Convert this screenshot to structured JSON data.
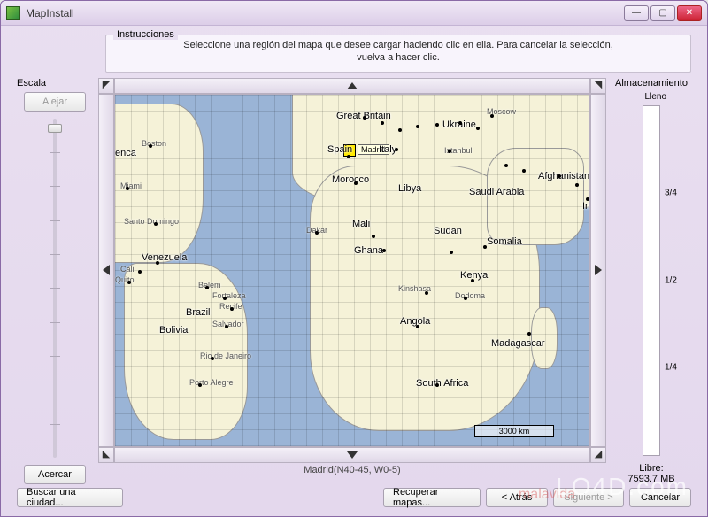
{
  "window": {
    "title": "MapInstall"
  },
  "instructions": {
    "legend": "Instrucciones",
    "body": "Seleccione una región del mapa que desee cargar haciendo clic en ella. Para cancelar la selección,\nvuelva a hacer clic."
  },
  "scale": {
    "label": "Escala",
    "zoom_out": "Alejar",
    "zoom_in": "Acercar"
  },
  "storage": {
    "label": "Almacenamiento",
    "full": "Lleno",
    "three_quarter": "3/4",
    "half": "1/2",
    "quarter": "1/4",
    "free_label": "Libre:",
    "free_value": "7593.7 MB"
  },
  "map": {
    "selected_city": "Madrid",
    "selected_coords": "Madrid(N40-45, W0-5)",
    "tooltip": "Madrid",
    "scalebar": "3000 km",
    "countries": {
      "great_britain": "Great Britain",
      "ukraine": "Ukraine",
      "spain": "Spain",
      "italy": "Italy",
      "morocco": "Morocco",
      "libya": "Libya",
      "saudi_arabia": "Saudi Arabia",
      "afghanistan": "Afghanistan",
      "india": "Ind",
      "mali": "Mali",
      "sudan": "Sudan",
      "somalia": "Somalia",
      "ghana": "Ghana",
      "kenya": "Kenya",
      "angola": "Angola",
      "madagascar": "Madagascar",
      "south_africa": "South Africa",
      "venezuela": "Venezuela",
      "bolivia": "Bolivia",
      "brazil": "Brazil",
      "enca": "enca"
    },
    "cities": {
      "moscow": "Moscow",
      "istanbul": "Istanbul",
      "boston": "Boston",
      "miami": "Miami",
      "santo_domingo": "Santo Domingo",
      "cali": "Cali",
      "quito": "Quito",
      "belem": "Belem",
      "fortaleza": "Fortaleza",
      "recife": "Recife",
      "salvador": "Salvador",
      "rio": "Rio de Janeiro",
      "porto_alegre": "Porto Alegre",
      "dakar": "Dakar",
      "kinshasa": "Kinshasa",
      "dodoma": "Dodoma"
    }
  },
  "footer": {
    "search_city": "Buscar una ciudad...",
    "recover_maps": "Recuperar mapas...",
    "back": "< Atrás",
    "next": "Siguiente >",
    "cancel": "Cancelar"
  },
  "watermark": "LO4D.com",
  "watermark2": "malavida"
}
